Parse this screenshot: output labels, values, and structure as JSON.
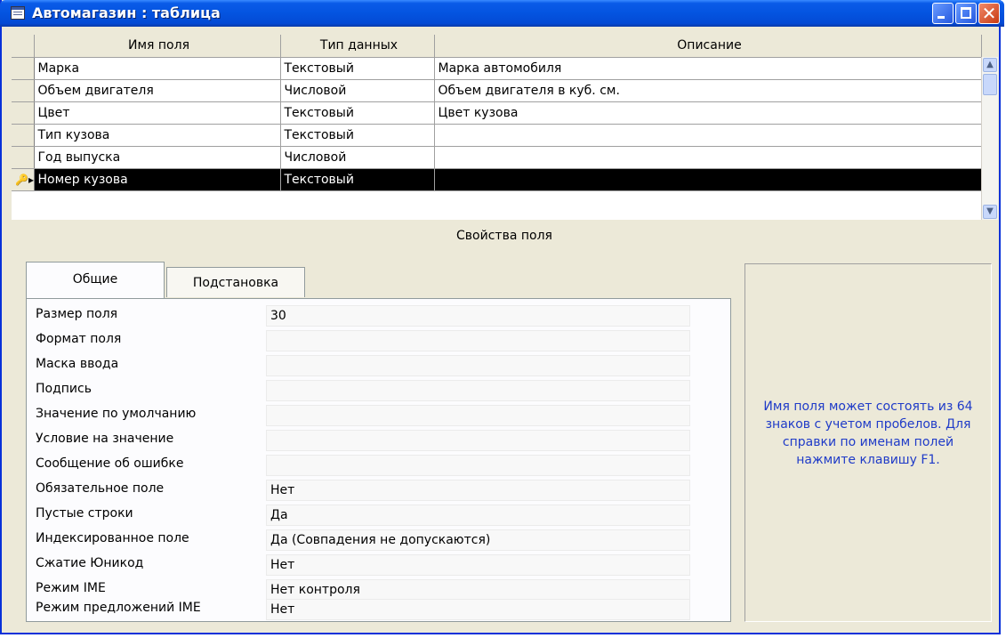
{
  "window": {
    "title": "Автомагазин : таблица"
  },
  "grid": {
    "headers": [
      "Имя поля",
      "Тип данных",
      "Описание"
    ],
    "rows": [
      {
        "name": "Марка",
        "type": "Текстовый",
        "description": "Марка автомобиля"
      },
      {
        "name": "Объем двигателя",
        "type": "Числовой",
        "description": "Объем двигателя в куб. см."
      },
      {
        "name": "Цвет",
        "type": "Текстовый",
        "description": "Цвет кузова"
      },
      {
        "name": "Тип кузова",
        "type": "Текстовый",
        "description": ""
      },
      {
        "name": "Год выпуска",
        "type": "Числовой",
        "description": ""
      },
      {
        "name": "Номер кузова",
        "type": "Текстовый",
        "description": ""
      }
    ],
    "current_row_marker": "🔑▸"
  },
  "properties": {
    "section_label": "Свойства поля",
    "tabs": [
      "Общие",
      "Подстановка"
    ],
    "fields": [
      {
        "label": "Размер поля",
        "value": "30"
      },
      {
        "label": "Формат поля",
        "value": ""
      },
      {
        "label": "Маска ввода",
        "value": ""
      },
      {
        "label": "Подпись",
        "value": ""
      },
      {
        "label": "Значение по умолчанию",
        "value": ""
      },
      {
        "label": "Условие на значение",
        "value": ""
      },
      {
        "label": "Сообщение об ошибке",
        "value": ""
      },
      {
        "label": "Обязательное поле",
        "value": "Нет"
      },
      {
        "label": "Пустые строки",
        "value": "Да"
      },
      {
        "label": "Индексированное поле",
        "value": "Да (Совпадения не допускаются)"
      },
      {
        "label": "Сжатие Юникод",
        "value": "Нет"
      },
      {
        "label": "Режим IME",
        "value": "Нет контроля"
      },
      {
        "label": "Режим предложений IME",
        "value": "Нет"
      }
    ],
    "help_text": "Имя поля может состоять из 64 знаков с учетом пробелов. Для справки по именам полей нажмите клавишу F1."
  },
  "icons": {
    "window_icon": "table-icon",
    "minimize": "minimize-icon",
    "maximize": "maximize-icon",
    "close": "close-icon",
    "scroll_up": "arrow-up-icon",
    "scroll_down": "arrow-down-icon"
  },
  "colors": {
    "title_bar": "#0454e0",
    "selected_row": "#000000",
    "help_text": "#1f3bc8"
  }
}
